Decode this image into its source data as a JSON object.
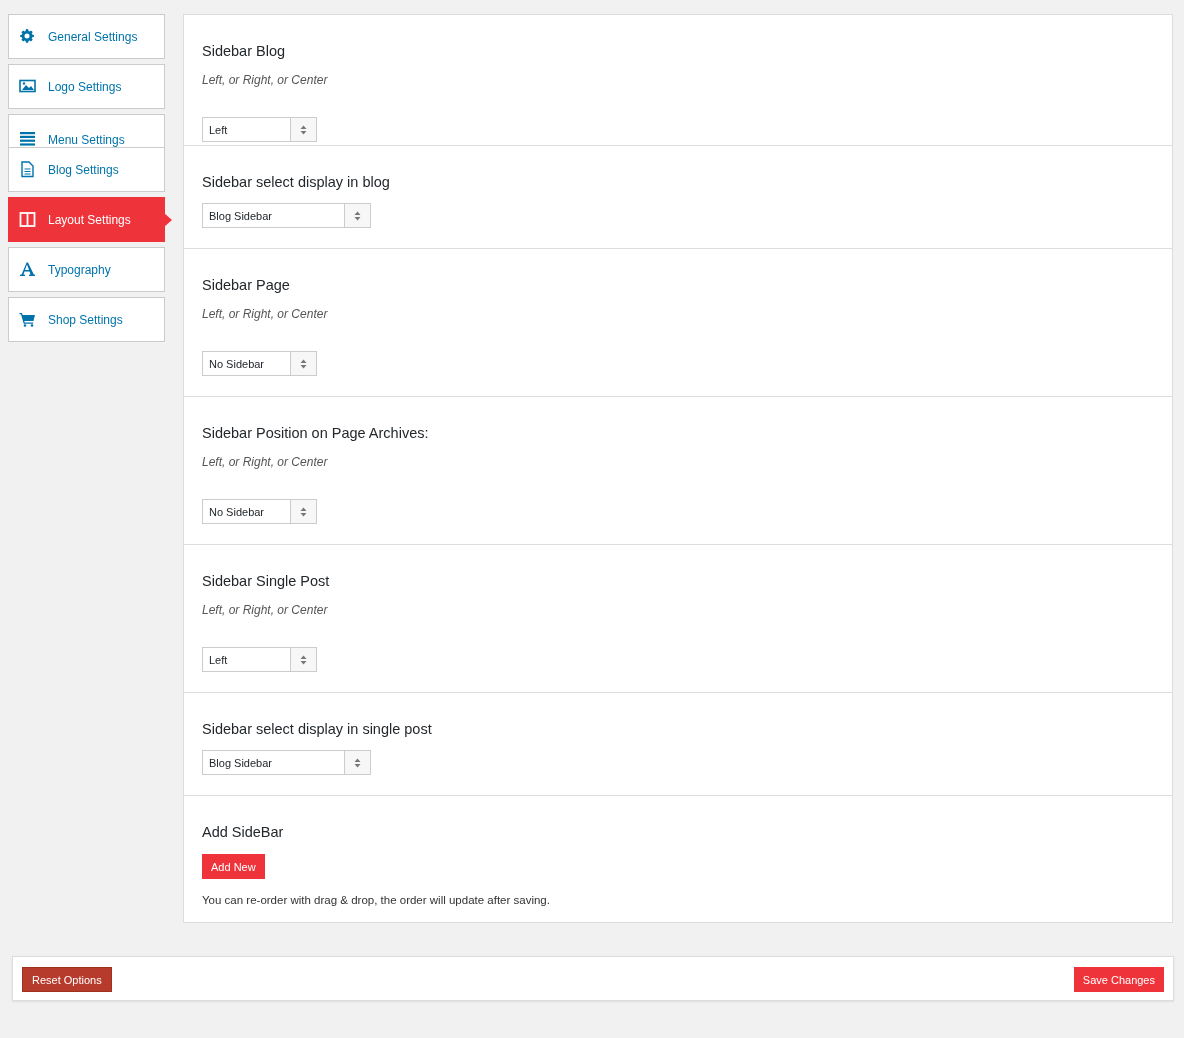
{
  "nav": [
    {
      "kind": "gear",
      "label": "General Settings",
      "selected": false,
      "cut": false
    },
    {
      "kind": "image",
      "label": "Logo Settings",
      "selected": false,
      "cut": false
    },
    {
      "kind": "lines",
      "label": "Menu Settings",
      "selected": false,
      "cut": true
    },
    {
      "kind": "document",
      "label": "Blog Settings",
      "selected": false,
      "cut": false
    },
    {
      "kind": "columns",
      "label": "Layout Settings",
      "selected": true,
      "cut": false
    },
    {
      "kind": "letter",
      "label": "Typography",
      "selected": false,
      "cut": false
    },
    {
      "kind": "cart",
      "label": "Shop Settings",
      "selected": false,
      "cut": false
    }
  ],
  "sections": [
    {
      "title": "Sidebar Blog",
      "description": "Left, or Right, or Center",
      "select": {
        "value": "Left",
        "kind": "narrow"
      }
    },
    {
      "title": "Sidebar select display in blog",
      "select": {
        "value": "Blog Sidebar",
        "kind": "wide"
      }
    },
    {
      "title": "Sidebar Page",
      "description": "Left, or Right, or Center",
      "select": {
        "value": "No Sidebar",
        "kind": "narrow"
      }
    },
    {
      "title": "Sidebar Position on Page Archives:",
      "description": "Left, or Right, or Center",
      "select": {
        "value": "No Sidebar",
        "kind": "narrow"
      }
    },
    {
      "title": "Sidebar Single Post",
      "description": "Left, or Right, or Center",
      "select": {
        "value": "Left",
        "kind": "narrow"
      }
    },
    {
      "title": "Sidebar select display in single post",
      "select": {
        "value": "Blog Sidebar",
        "kind": "wide"
      }
    },
    {
      "title": "Add SideBar",
      "button": "Add New",
      "note": "You can re-order with drag & drop, the order will update after saving."
    }
  ],
  "footer": {
    "reset": "Reset Options",
    "save": "Save Changes"
  }
}
